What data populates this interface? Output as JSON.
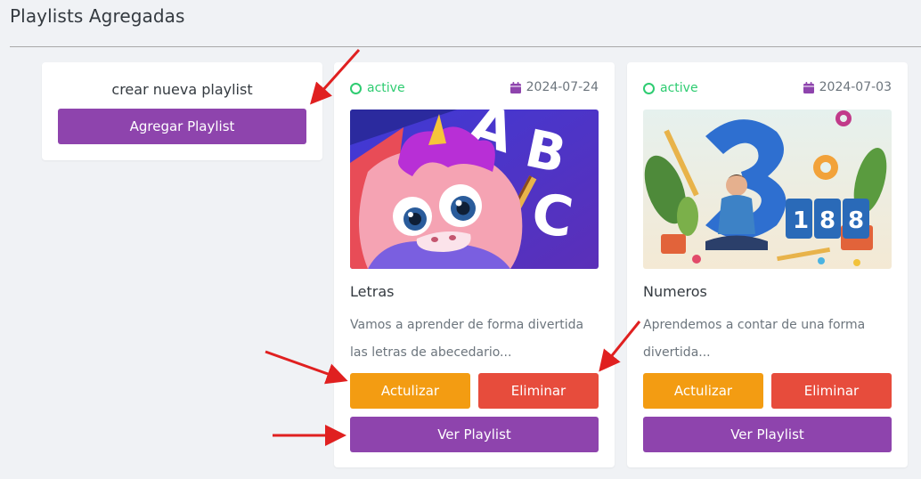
{
  "page": {
    "title": "Playlists Agregadas"
  },
  "create_card": {
    "title": "crear nueva playlist",
    "button_label": "Agregar Playlist"
  },
  "playlists": [
    {
      "status": "active",
      "date": "2024-07-24",
      "name": "Letras",
      "description": "Vamos a aprender de forma divertida las letras de abecedario...",
      "update_label": "Actulizar",
      "delete_label": "Eliminar",
      "view_label": "Ver Playlist"
    },
    {
      "status": "active",
      "date": "2024-07-03",
      "name": "Numeros",
      "description": "Aprendemos a contar de una forma divertida...",
      "update_label": "Actulizar",
      "delete_label": "Eliminar",
      "view_label": "Ver Playlist"
    }
  ],
  "colors": {
    "primary_purple": "#8e44ad",
    "update_orange": "#f39c12",
    "delete_red": "#e74c3c",
    "status_green": "#2ecc71",
    "calendar_purple": "#8e44ad",
    "annotation_red": "#e02020"
  },
  "icons": {
    "status": "circle-status-icon",
    "date": "calendar-icon"
  }
}
